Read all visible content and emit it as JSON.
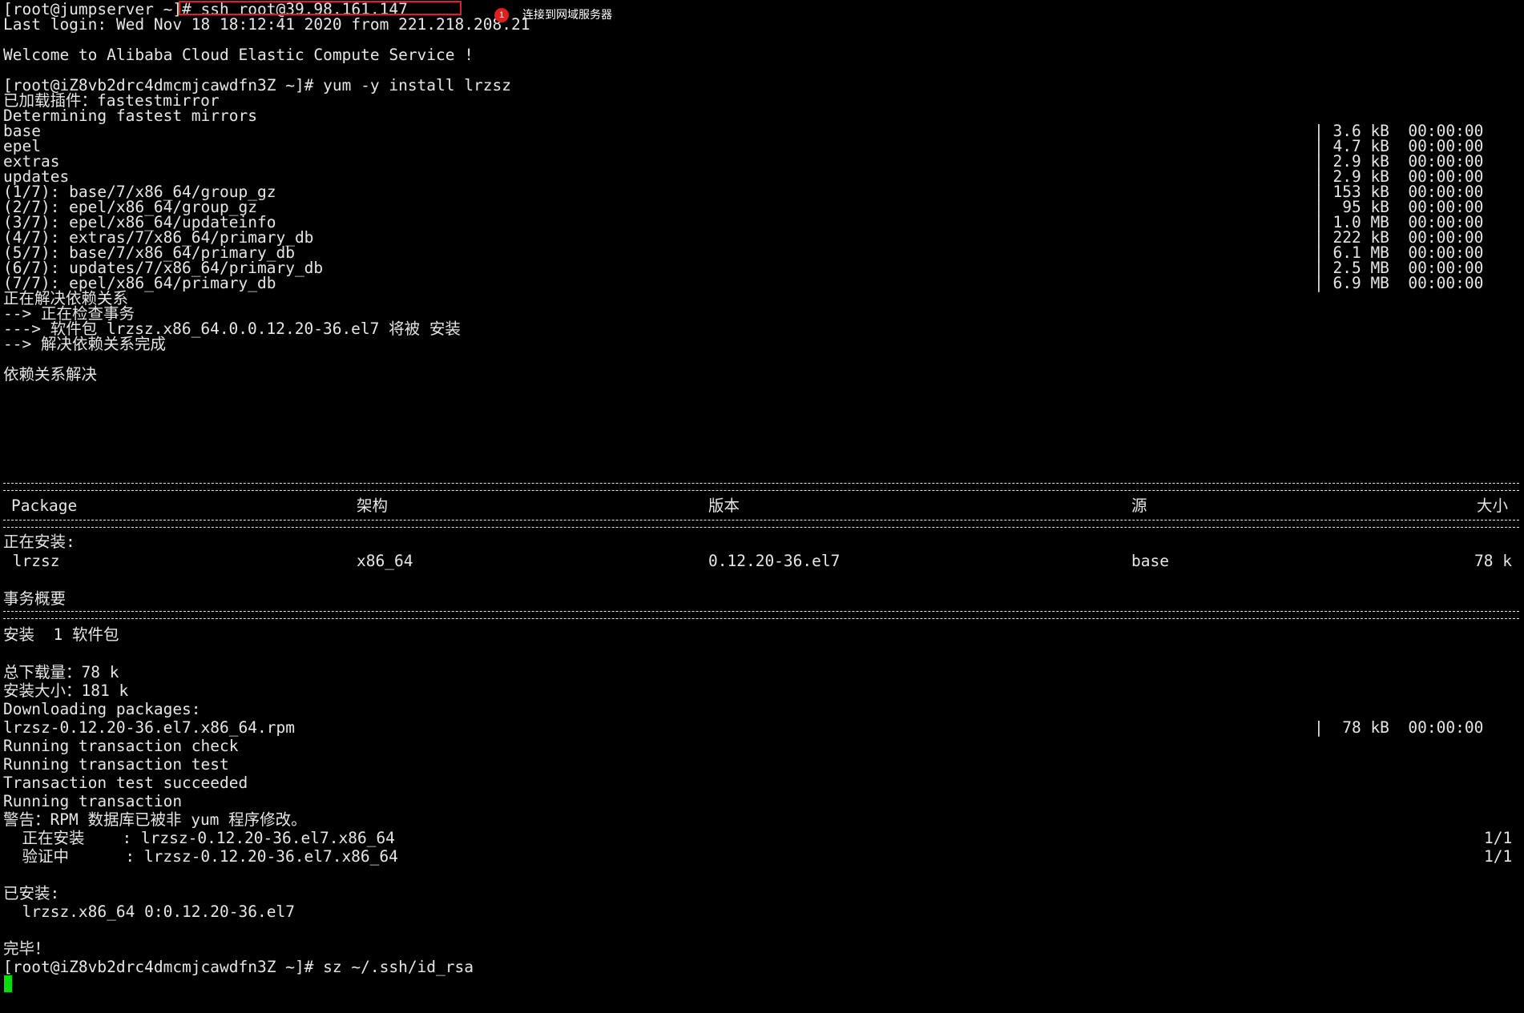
{
  "annotation": {
    "badge": "1",
    "text": "连接到网域服务器",
    "box_color": "#e0201f",
    "badge_color": "#e0201f"
  },
  "terminal": {
    "background": "#000000",
    "foreground": "#e6e6e6",
    "cursor_color": "#00e000",
    "header": [
      "[root@jumpserver ~]# ssh root@39.98.161.147",
      "Last login: Wed Nov 18 18:12:41 2020 from 221.218.208.21",
      "",
      "Welcome to Alibaba Cloud Elastic Compute Service !",
      "",
      "[root@iZ8vb2drc4dmcmjcawdfn3Z ~]# yum -y install lrzsz",
      "已加载插件：fastestmirror",
      "Determining fastest mirrors"
    ],
    "repos": [
      {
        "name": "base",
        "size": "| 3.6 kB  00:00:00"
      },
      {
        "name": "epel",
        "size": "| 4.7 kB  00:00:00"
      },
      {
        "name": "extras",
        "size": "| 2.9 kB  00:00:00"
      },
      {
        "name": "updates",
        "size": "| 2.9 kB  00:00:00"
      },
      {
        "name": "(1/7): base/7/x86_64/group_gz",
        "size": "| 153 kB  00:00:00"
      },
      {
        "name": "(2/7): epel/x86_64/group_gz",
        "size": "|  95 kB  00:00:00"
      },
      {
        "name": "(3/7): epel/x86_64/updateinfo",
        "size": "| 1.0 MB  00:00:00"
      },
      {
        "name": "(4/7): extras/7/x86_64/primary_db",
        "size": "| 222 kB  00:00:00"
      },
      {
        "name": "(5/7): base/7/x86_64/primary_db",
        "size": "| 6.1 MB  00:00:00"
      },
      {
        "name": "(6/7): updates/7/x86_64/primary_db",
        "size": "| 2.5 MB  00:00:00"
      },
      {
        "name": "(7/7): epel/x86_64/primary_db",
        "size": "| 6.9 MB  00:00:00"
      }
    ],
    "resolve": [
      "正在解决依赖关系",
      "--> 正在检查事务",
      "---> 软件包 lrzsz.x86_64.0.0.12.20-36.el7 将被 安装",
      "--> 解决依赖关系完成",
      "",
      "依赖关系解决"
    ],
    "table": {
      "headers": [
        "Package",
        "架构",
        "版本",
        "源",
        "大小"
      ],
      "section": "正在安装:",
      "row": [
        " lrzsz",
        "x86_64",
        "0.12.20-36.el7",
        "base",
        "78 k"
      ]
    },
    "summary_title": "事务概要",
    "summary": [
      "安装  1 软件包",
      "",
      "总下载量：78 k",
      "安装大小：181 k",
      "Downloading packages:"
    ],
    "download": {
      "name": "lrzsz-0.12.20-36.el7.x86_64.rpm",
      "size": "|  78 kB  00:00:00"
    },
    "transaction": [
      "Running transaction check",
      "Running transaction test",
      "Transaction test succeeded",
      "Running transaction",
      "警告：RPM 数据库已被非 yum 程序修改。"
    ],
    "steps": [
      {
        "text": "  正在安装    : lrzsz-0.12.20-36.el7.x86_64",
        "count": "1/1"
      },
      {
        "text": "  验证中      : lrzsz-0.12.20-36.el7.x86_64",
        "count": "1/1"
      }
    ],
    "footer": [
      "",
      "已安装:",
      "  lrzsz.x86_64 0:0.12.20-36.el7",
      "",
      "完毕！",
      "[root@iZ8vb2drc4dmcmjcawdfn3Z ~]# sz ~/.ssh/id_rsa"
    ]
  }
}
